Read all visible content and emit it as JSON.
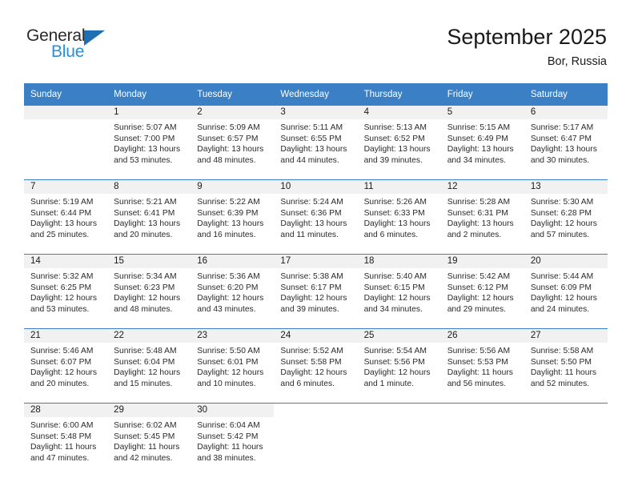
{
  "brand": {
    "name_part1": "General",
    "name_part2": "Blue",
    "accent_color": "#2a8fd4",
    "triangle_color": "#1f6fb5",
    "triangle_icon": "triangle-icon"
  },
  "header": {
    "title": "September 2025",
    "subtitle": "Bor, Russia"
  },
  "theme": {
    "header_row_bg": "#3b7fc4",
    "daynum_band_bg": "#f1f1f1",
    "grid_line": "#3b7fc4"
  },
  "weekday_headers": [
    "Sunday",
    "Monday",
    "Tuesday",
    "Wednesday",
    "Thursday",
    "Friday",
    "Saturday"
  ],
  "weeks": [
    [
      {
        "day": "",
        "sunrise": "",
        "sunset": "",
        "daylight1": "",
        "daylight2": "",
        "empty": true
      },
      {
        "day": "1",
        "sunrise": "Sunrise: 5:07 AM",
        "sunset": "Sunset: 7:00 PM",
        "daylight1": "Daylight: 13 hours",
        "daylight2": "and 53 minutes."
      },
      {
        "day": "2",
        "sunrise": "Sunrise: 5:09 AM",
        "sunset": "Sunset: 6:57 PM",
        "daylight1": "Daylight: 13 hours",
        "daylight2": "and 48 minutes."
      },
      {
        "day": "3",
        "sunrise": "Sunrise: 5:11 AM",
        "sunset": "Sunset: 6:55 PM",
        "daylight1": "Daylight: 13 hours",
        "daylight2": "and 44 minutes."
      },
      {
        "day": "4",
        "sunrise": "Sunrise: 5:13 AM",
        "sunset": "Sunset: 6:52 PM",
        "daylight1": "Daylight: 13 hours",
        "daylight2": "and 39 minutes."
      },
      {
        "day": "5",
        "sunrise": "Sunrise: 5:15 AM",
        "sunset": "Sunset: 6:49 PM",
        "daylight1": "Daylight: 13 hours",
        "daylight2": "and 34 minutes."
      },
      {
        "day": "6",
        "sunrise": "Sunrise: 5:17 AM",
        "sunset": "Sunset: 6:47 PM",
        "daylight1": "Daylight: 13 hours",
        "daylight2": "and 30 minutes."
      }
    ],
    [
      {
        "day": "7",
        "sunrise": "Sunrise: 5:19 AM",
        "sunset": "Sunset: 6:44 PM",
        "daylight1": "Daylight: 13 hours",
        "daylight2": "and 25 minutes."
      },
      {
        "day": "8",
        "sunrise": "Sunrise: 5:21 AM",
        "sunset": "Sunset: 6:41 PM",
        "daylight1": "Daylight: 13 hours",
        "daylight2": "and 20 minutes."
      },
      {
        "day": "9",
        "sunrise": "Sunrise: 5:22 AM",
        "sunset": "Sunset: 6:39 PM",
        "daylight1": "Daylight: 13 hours",
        "daylight2": "and 16 minutes."
      },
      {
        "day": "10",
        "sunrise": "Sunrise: 5:24 AM",
        "sunset": "Sunset: 6:36 PM",
        "daylight1": "Daylight: 13 hours",
        "daylight2": "and 11 minutes."
      },
      {
        "day": "11",
        "sunrise": "Sunrise: 5:26 AM",
        "sunset": "Sunset: 6:33 PM",
        "daylight1": "Daylight: 13 hours",
        "daylight2": "and 6 minutes."
      },
      {
        "day": "12",
        "sunrise": "Sunrise: 5:28 AM",
        "sunset": "Sunset: 6:31 PM",
        "daylight1": "Daylight: 13 hours",
        "daylight2": "and 2 minutes."
      },
      {
        "day": "13",
        "sunrise": "Sunrise: 5:30 AM",
        "sunset": "Sunset: 6:28 PM",
        "daylight1": "Daylight: 12 hours",
        "daylight2": "and 57 minutes."
      }
    ],
    [
      {
        "day": "14",
        "sunrise": "Sunrise: 5:32 AM",
        "sunset": "Sunset: 6:25 PM",
        "daylight1": "Daylight: 12 hours",
        "daylight2": "and 53 minutes."
      },
      {
        "day": "15",
        "sunrise": "Sunrise: 5:34 AM",
        "sunset": "Sunset: 6:23 PM",
        "daylight1": "Daylight: 12 hours",
        "daylight2": "and 48 minutes."
      },
      {
        "day": "16",
        "sunrise": "Sunrise: 5:36 AM",
        "sunset": "Sunset: 6:20 PM",
        "daylight1": "Daylight: 12 hours",
        "daylight2": "and 43 minutes."
      },
      {
        "day": "17",
        "sunrise": "Sunrise: 5:38 AM",
        "sunset": "Sunset: 6:17 PM",
        "daylight1": "Daylight: 12 hours",
        "daylight2": "and 39 minutes."
      },
      {
        "day": "18",
        "sunrise": "Sunrise: 5:40 AM",
        "sunset": "Sunset: 6:15 PM",
        "daylight1": "Daylight: 12 hours",
        "daylight2": "and 34 minutes."
      },
      {
        "day": "19",
        "sunrise": "Sunrise: 5:42 AM",
        "sunset": "Sunset: 6:12 PM",
        "daylight1": "Daylight: 12 hours",
        "daylight2": "and 29 minutes."
      },
      {
        "day": "20",
        "sunrise": "Sunrise: 5:44 AM",
        "sunset": "Sunset: 6:09 PM",
        "daylight1": "Daylight: 12 hours",
        "daylight2": "and 24 minutes."
      }
    ],
    [
      {
        "day": "21",
        "sunrise": "Sunrise: 5:46 AM",
        "sunset": "Sunset: 6:07 PM",
        "daylight1": "Daylight: 12 hours",
        "daylight2": "and 20 minutes."
      },
      {
        "day": "22",
        "sunrise": "Sunrise: 5:48 AM",
        "sunset": "Sunset: 6:04 PM",
        "daylight1": "Daylight: 12 hours",
        "daylight2": "and 15 minutes."
      },
      {
        "day": "23",
        "sunrise": "Sunrise: 5:50 AM",
        "sunset": "Sunset: 6:01 PM",
        "daylight1": "Daylight: 12 hours",
        "daylight2": "and 10 minutes."
      },
      {
        "day": "24",
        "sunrise": "Sunrise: 5:52 AM",
        "sunset": "Sunset: 5:58 PM",
        "daylight1": "Daylight: 12 hours",
        "daylight2": "and 6 minutes."
      },
      {
        "day": "25",
        "sunrise": "Sunrise: 5:54 AM",
        "sunset": "Sunset: 5:56 PM",
        "daylight1": "Daylight: 12 hours",
        "daylight2": "and 1 minute."
      },
      {
        "day": "26",
        "sunrise": "Sunrise: 5:56 AM",
        "sunset": "Sunset: 5:53 PM",
        "daylight1": "Daylight: 11 hours",
        "daylight2": "and 56 minutes."
      },
      {
        "day": "27",
        "sunrise": "Sunrise: 5:58 AM",
        "sunset": "Sunset: 5:50 PM",
        "daylight1": "Daylight: 11 hours",
        "daylight2": "and 52 minutes."
      }
    ],
    [
      {
        "day": "28",
        "sunrise": "Sunrise: 6:00 AM",
        "sunset": "Sunset: 5:48 PM",
        "daylight1": "Daylight: 11 hours",
        "daylight2": "and 47 minutes."
      },
      {
        "day": "29",
        "sunrise": "Sunrise: 6:02 AM",
        "sunset": "Sunset: 5:45 PM",
        "daylight1": "Daylight: 11 hours",
        "daylight2": "and 42 minutes."
      },
      {
        "day": "30",
        "sunrise": "Sunrise: 6:04 AM",
        "sunset": "Sunset: 5:42 PM",
        "daylight1": "Daylight: 11 hours",
        "daylight2": "and 38 minutes."
      },
      {
        "day": "",
        "sunrise": "",
        "sunset": "",
        "daylight1": "",
        "daylight2": "",
        "blank": true
      },
      {
        "day": "",
        "sunrise": "",
        "sunset": "",
        "daylight1": "",
        "daylight2": "",
        "blank": true
      },
      {
        "day": "",
        "sunrise": "",
        "sunset": "",
        "daylight1": "",
        "daylight2": "",
        "blank": true
      },
      {
        "day": "",
        "sunrise": "",
        "sunset": "",
        "daylight1": "",
        "daylight2": "",
        "blank": true
      }
    ]
  ]
}
